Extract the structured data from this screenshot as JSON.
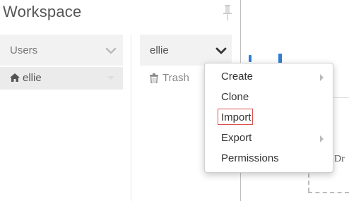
{
  "workspace": {
    "title": "Workspace",
    "pin_icon": "thumbtack-icon"
  },
  "columns": [
    {
      "header": "Users",
      "header_icon": "chevron-down-icon",
      "items": [
        {
          "label": "ellie",
          "icon": "home-icon",
          "selected": true
        }
      ]
    },
    {
      "header": "ellie",
      "header_icon": "chevron-down-icon",
      "items": [
        {
          "label": "Trash",
          "icon": "trash-icon"
        }
      ]
    }
  ],
  "context_menu": {
    "items": [
      {
        "label": "Create",
        "has_submenu": true
      },
      {
        "label": "Clone",
        "has_submenu": false
      },
      {
        "label": "Import",
        "has_submenu": false,
        "highlighted": true
      },
      {
        "label": "Export",
        "has_submenu": true
      },
      {
        "label": "Permissions",
        "has_submenu": false
      }
    ]
  },
  "content_pane": {
    "drop_zone_text": "Dr"
  },
  "colors": {
    "header_bg": "#f2f2f2",
    "selected_row_bg": "#ebebeb",
    "accent_blue": "#2f7fd0",
    "highlight_border": "#d9534f"
  }
}
